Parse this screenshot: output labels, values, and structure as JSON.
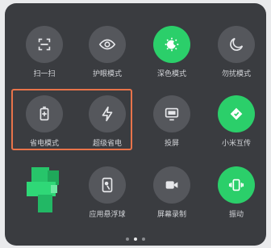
{
  "tiles": [
    {
      "label": "扫一扫",
      "icon": "scan-icon",
      "on": false
    },
    {
      "label": "护眼模式",
      "icon": "eye-icon",
      "on": false
    },
    {
      "label": "深色模式",
      "icon": "dark-mode-icon",
      "on": true
    },
    {
      "label": "勿扰模式",
      "icon": "moon-icon",
      "on": false
    },
    {
      "label": "省电模式",
      "icon": "battery-icon",
      "on": false
    },
    {
      "label": "超级省电",
      "icon": "lightning-icon",
      "on": false
    },
    {
      "label": "投屏",
      "icon": "screen-cast-icon",
      "on": false
    },
    {
      "label": "小米互传",
      "icon": "mi-share-icon",
      "on": true
    },
    {
      "label": "",
      "icon": "blurred-app-icon",
      "on": false
    },
    {
      "label": "应用悬浮球",
      "icon": "floating-ball-icon",
      "on": false
    },
    {
      "label": "屏幕录制",
      "icon": "screen-record-icon",
      "on": false
    },
    {
      "label": "振动",
      "icon": "vibrate-icon",
      "on": true
    }
  ],
  "pagination": {
    "pages": 3,
    "active": 1
  },
  "colors": {
    "panel": "#3a3c40",
    "tile": "#55575c",
    "active": "#2bcf6a",
    "highlight": "#e8734a"
  }
}
